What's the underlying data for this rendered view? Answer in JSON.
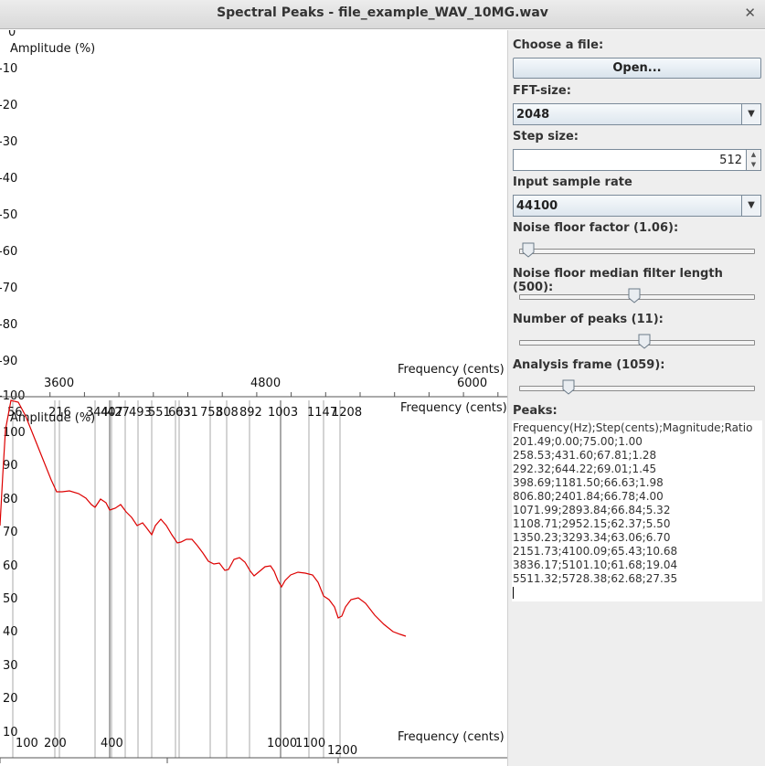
{
  "window": {
    "title": "Spectral Peaks - file_example_WAV_10MG.wav",
    "close_glyph": "✕"
  },
  "top_plot": {
    "ylabel": "Amplitude (%)",
    "xlabel_a": "Frequency (cents)",
    "xlabel_b": "Frequency (cents)",
    "y_ticks": [
      "0",
      "-10",
      "-20",
      "-30",
      "-40",
      "-50",
      "-60",
      "-70",
      "-80",
      "-90",
      "100"
    ],
    "x_ticks": [
      "3600",
      "4800",
      "6000"
    ]
  },
  "bottom_plot": {
    "ylabel": "Amplitude (%)",
    "xlabel": "Frequency (cents)",
    "y_ticks": [
      "100",
      "90",
      "80",
      "70",
      "60",
      "50",
      "40",
      "30",
      "20",
      "10"
    ],
    "x_ticks_bottom": [
      "100",
      "200",
      "400",
      "1000",
      "1100",
      "1200"
    ],
    "peak_labels": [
      "56",
      "216",
      "344",
      "407",
      "427",
      "493",
      "551",
      "603",
      "631",
      "753",
      "808",
      "892",
      "1003",
      "1147",
      "1208"
    ],
    "line_color": "#dd0000",
    "marker_color": "#a8a8a8"
  },
  "controls": {
    "choose_label": "Choose a file:",
    "open_label": "Open...",
    "fft_label": "FFT-size:",
    "fft_value": "2048",
    "step_label": "Step size:",
    "step_value": "512",
    "rate_label": "Input sample rate",
    "rate_value": "44100",
    "noise_factor_label": "Noise floor factor (1.06):",
    "noise_factor_position": 0.04,
    "median_label": "Noise floor median filter length (500):",
    "median_position": 0.49,
    "num_peaks_label": "Number of peaks (11):",
    "num_peaks_position": 0.53,
    "frame_label": "Analysis frame (1059):",
    "frame_position": 0.21,
    "peaks_label": "Peaks:"
  },
  "peaks_text": [
    "Frequency(Hz);Step(cents);Magnitude;Ratio",
    "201.49;0.00;75.00;1.00",
    "258.53;431.60;67.81;1.28",
    "292.32;644.22;69.01;1.45",
    "398.69;1181.50;66.63;1.98",
    "806.80;2401.84;66.78;4.00",
    "1071.99;2893.84;66.84;5.32",
    "1108.71;2952.15;62.37;5.50",
    "1350.23;3293.34;63.06;6.70",
    "2151.73;4100.09;65.43;10.68",
    "3836.17;5101.10;61.68;19.04",
    "5511.32;5728.38;62.68;27.35"
  ]
}
